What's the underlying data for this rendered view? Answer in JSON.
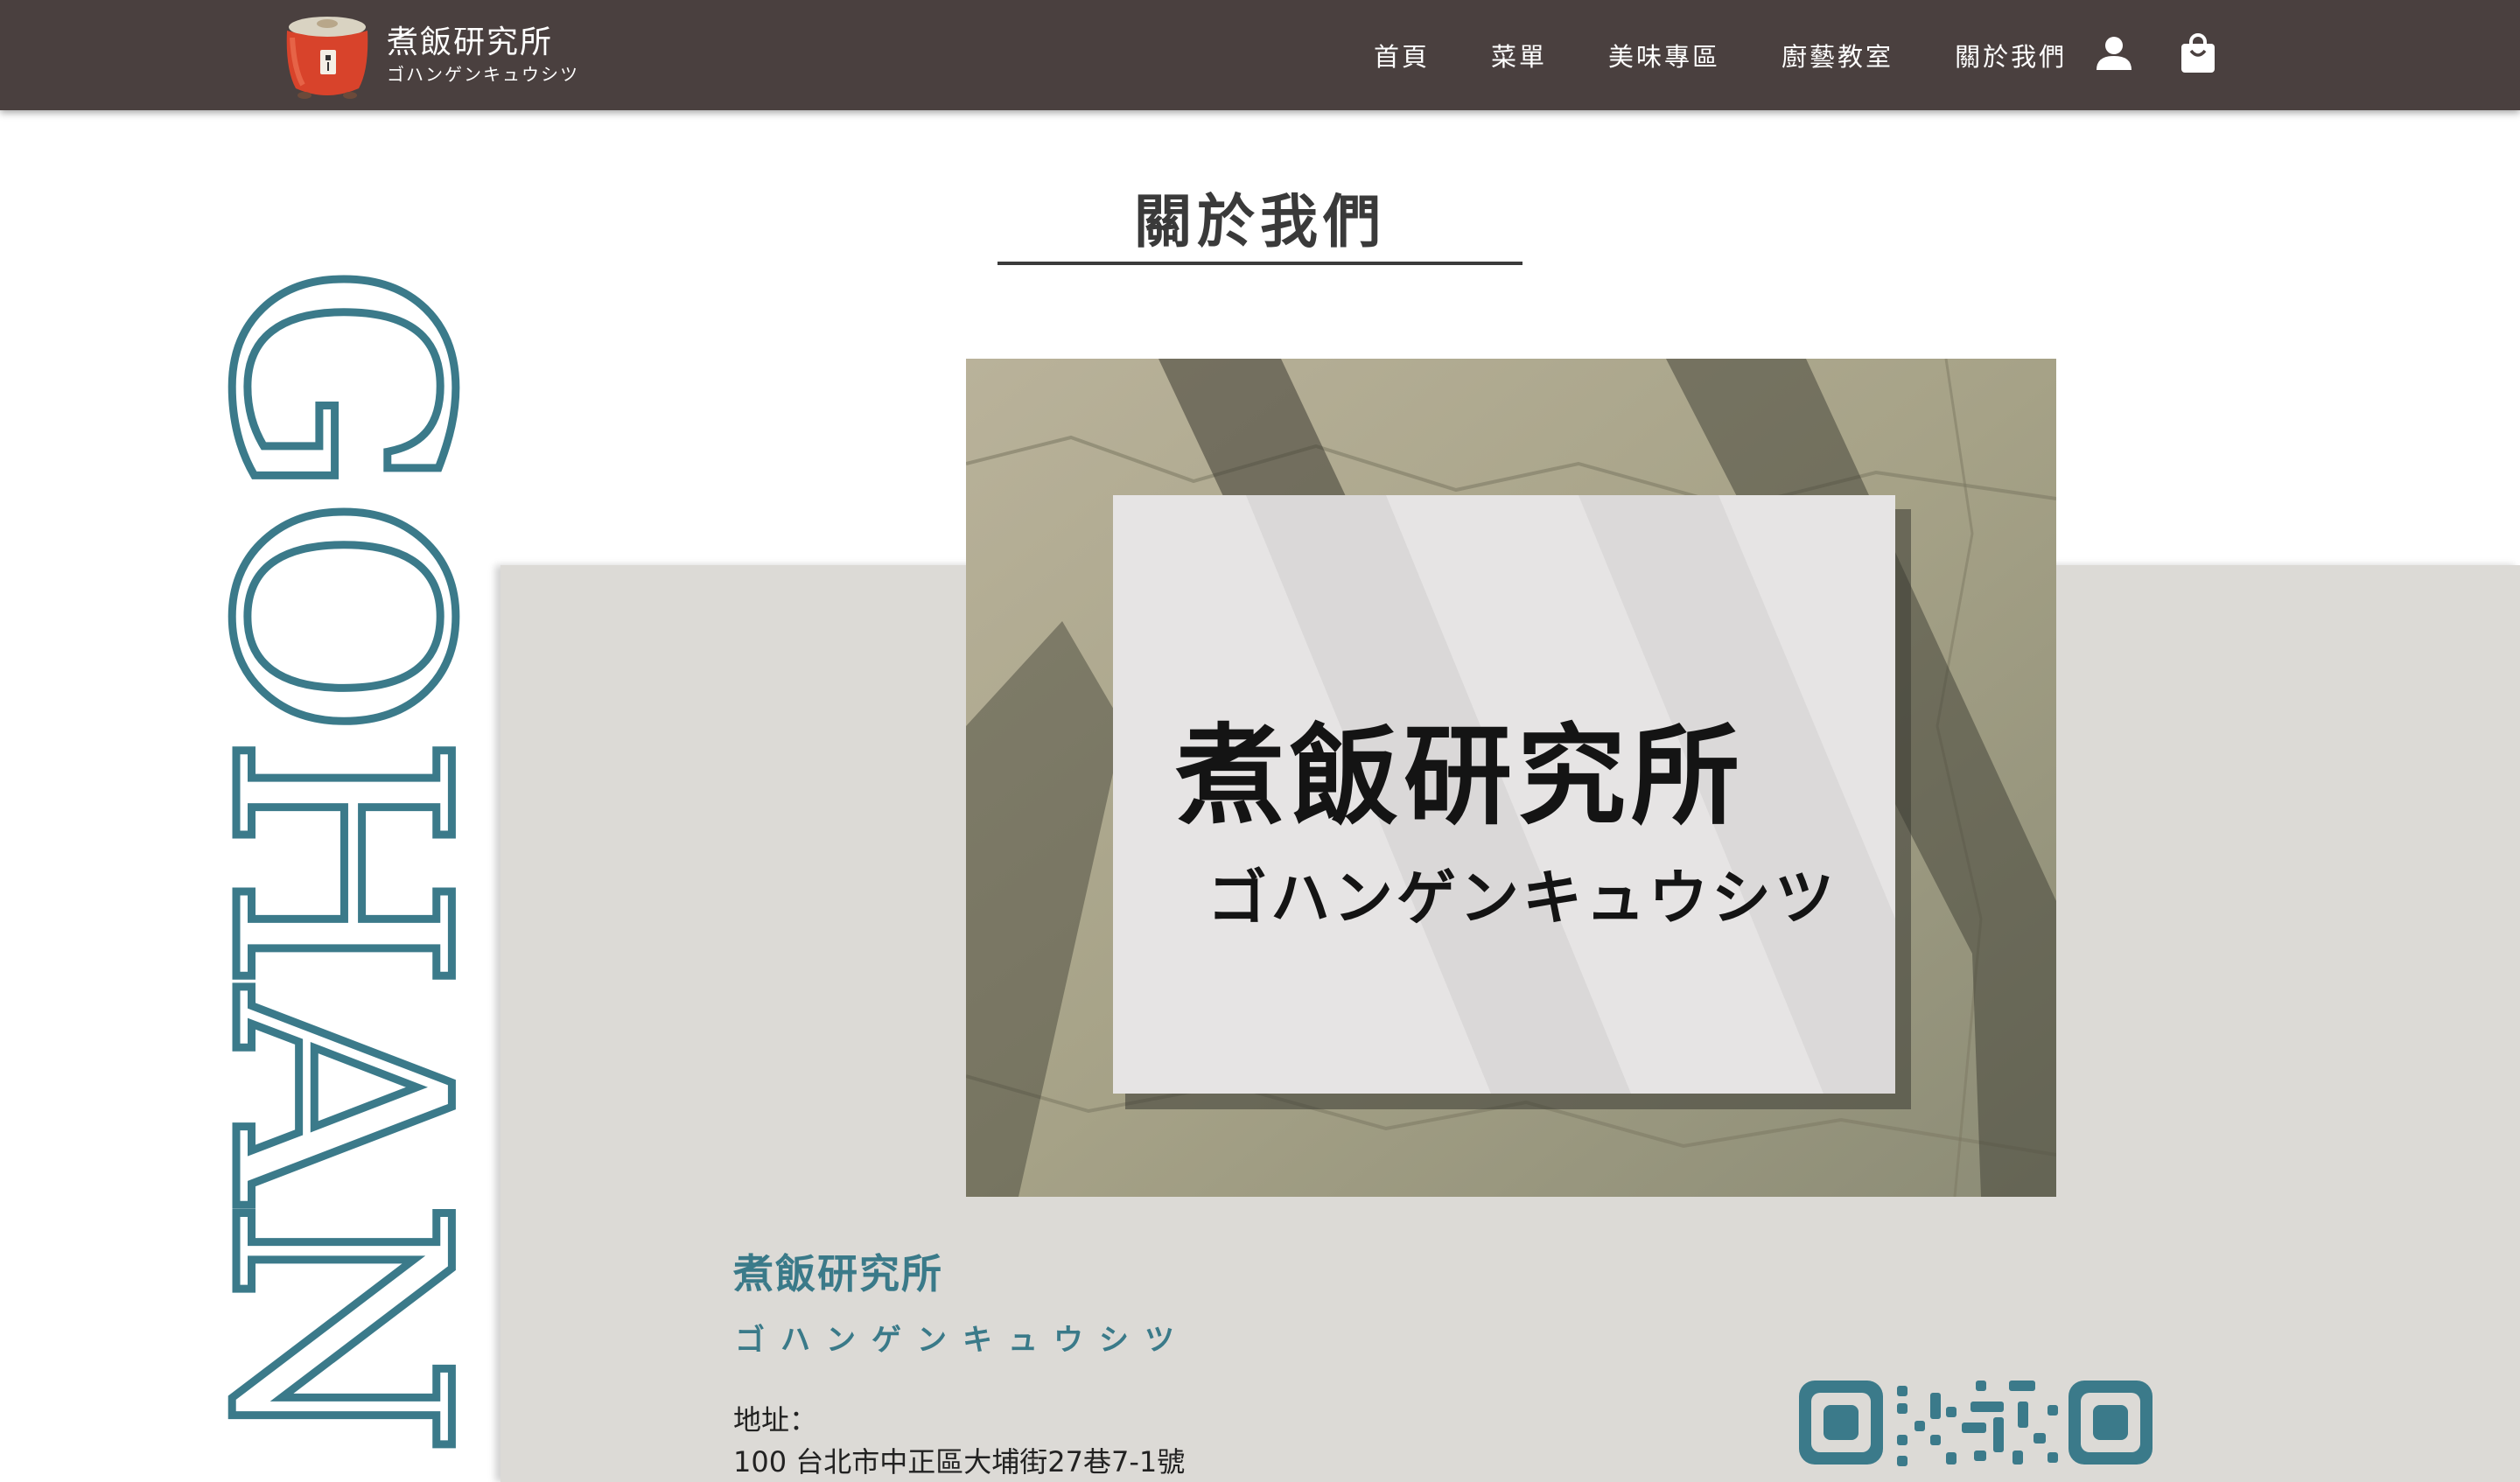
{
  "brand": {
    "title": "煮飯研究所",
    "subtitle": "ゴハンゲンキュウシツ"
  },
  "nav": {
    "items": [
      "首頁",
      "菜單",
      "美味專區",
      "廚藝教室",
      "關於我們"
    ],
    "account_icon": "person-icon",
    "cart_icon": "shopping-bag-icon"
  },
  "page": {
    "title": "關於我們",
    "vertical_text": "GOHAN"
  },
  "photo": {
    "sign_title": "煮飯研究所",
    "sign_subtitle": "ゴハンゲンキュウシツ"
  },
  "info": {
    "name": "煮飯研究所",
    "kana": "ゴハンゲンキュウシツ",
    "address_label": "地址：",
    "address": "100 台北市中正區大埔街27巷7-1號"
  },
  "colors": {
    "navbar": "#4a403f",
    "accent": "#3a7a89",
    "panel": "#dcdad6"
  }
}
